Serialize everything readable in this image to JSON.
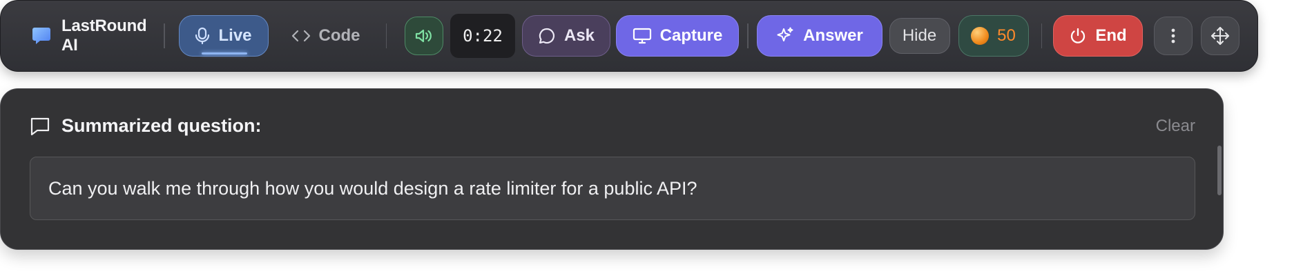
{
  "toolbar": {
    "brand": {
      "name": "LastRound AI",
      "icon": "chat-bubble-icon"
    },
    "live_label": "Live",
    "code_label": "Code",
    "sound_icon": "speaker-icon",
    "timer": "0:22",
    "ask_label": "Ask",
    "capture_label": "Capture",
    "answer_label": "Answer",
    "hide_label": "Hide",
    "coins": "50",
    "end_label": "End",
    "more_icon": "more-vertical-icon",
    "move_icon": "move-icon"
  },
  "panel": {
    "title": "Summarized question:",
    "clear_label": "Clear",
    "question": "Can you walk me through how you would design a rate limiter for a public API?"
  },
  "colors": {
    "accent_purple": "#6f67e6",
    "live_blue": "#3d5a8a",
    "end_red": "#cf4543",
    "coin_orange": "#ff8a2b"
  }
}
